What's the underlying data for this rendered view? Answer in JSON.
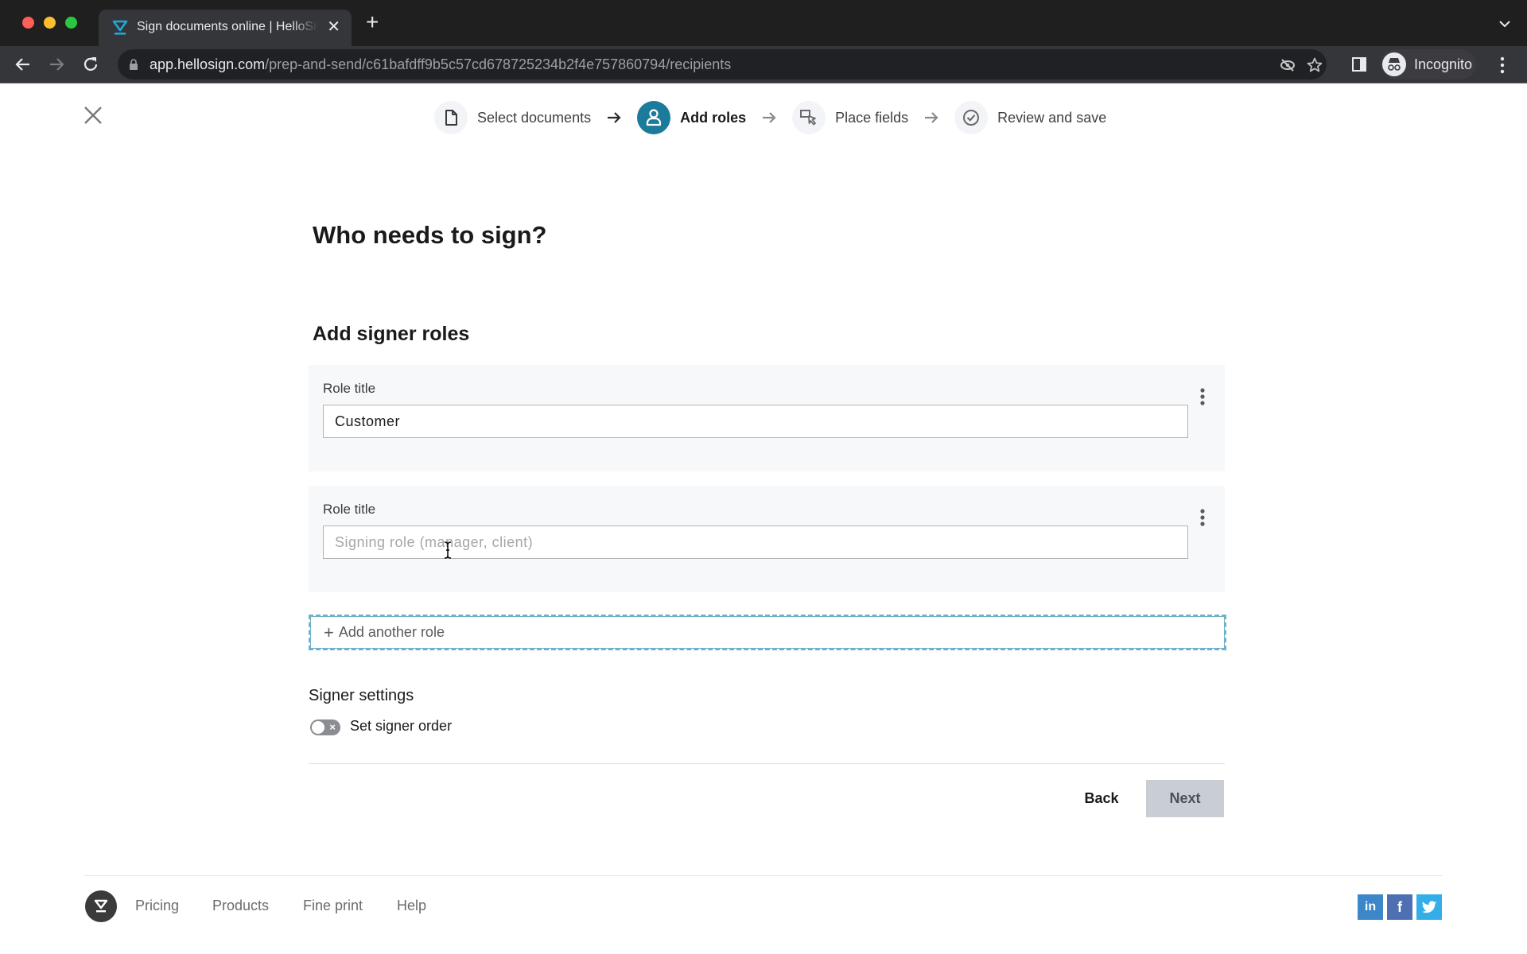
{
  "browser": {
    "tab_title": "Sign documents online | HelloSign",
    "url_host": "app.hellosign.com",
    "url_path": "/prep-and-send/c61bafdff9b5c57cd678725234b2f4e757860794/recipients",
    "profile_label": "Incognito"
  },
  "stepper": {
    "steps": [
      {
        "label": "Select documents",
        "icon": "document-icon",
        "state": "complete"
      },
      {
        "label": "Add roles",
        "icon": "person-icon",
        "state": "active"
      },
      {
        "label": "Place fields",
        "icon": "cursor-select-icon",
        "state": "pending"
      },
      {
        "label": "Review and save",
        "icon": "check-circle-icon",
        "state": "pending"
      }
    ]
  },
  "main": {
    "title": "Who needs to sign?",
    "section_title": "Add signer roles",
    "roles": [
      {
        "label": "Role title",
        "value": "Customer",
        "placeholder": "Signing role (manager, client)"
      },
      {
        "label": "Role title",
        "value": "",
        "placeholder": "Signing role (manager, client)"
      }
    ],
    "add_role_label": "Add another role",
    "settings_title": "Signer settings",
    "signer_order": {
      "label": "Set signer order",
      "enabled": false
    },
    "back_label": "Back",
    "next_label": "Next"
  },
  "footer": {
    "links": [
      "Pricing",
      "Products",
      "Fine print",
      "Help"
    ],
    "social": [
      {
        "name": "linkedin",
        "glyph": "in",
        "color": "#3b87c8"
      },
      {
        "name": "facebook",
        "glyph": "f",
        "color": "#4f6fb3"
      },
      {
        "name": "twitter",
        "glyph": "🐦",
        "color": "#34aee8"
      }
    ]
  },
  "colors": {
    "accent": "#1b7b9a",
    "add_role_border": "#6eb2c9",
    "next_disabled_bg": "#c8ced3"
  }
}
